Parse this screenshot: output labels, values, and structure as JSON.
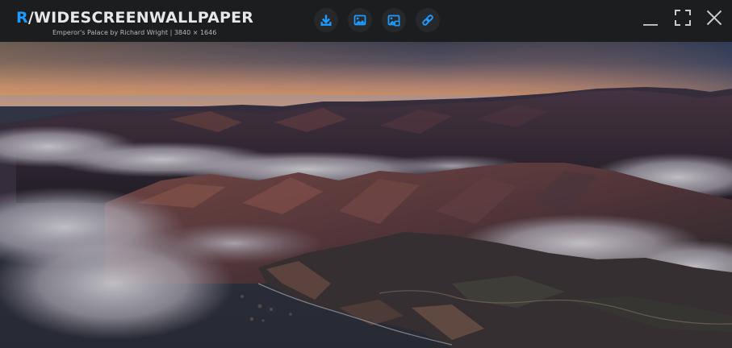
{
  "app": {
    "brand_prefix": "R",
    "brand_name": "/WIDESCREENWALLPAPER",
    "subtitle": "Emperor's Palace by Richard Wright | 3840 × 1646"
  },
  "toolbar": {
    "buttons": [
      {
        "icon": "download-icon"
      },
      {
        "icon": "image-icon"
      },
      {
        "icon": "image-gallery-icon"
      },
      {
        "icon": "link-icon"
      }
    ]
  },
  "window_controls": {
    "minimize_icon": "minimize-icon",
    "fullscreen_icon": "fullscreen-icon",
    "close_icon": "close-icon"
  },
  "colors": {
    "accent": "#1e9bff",
    "titlebar_bg": "#1c1d1f",
    "button_bg": "#26282b",
    "title_text": "#e6e7e8"
  }
}
